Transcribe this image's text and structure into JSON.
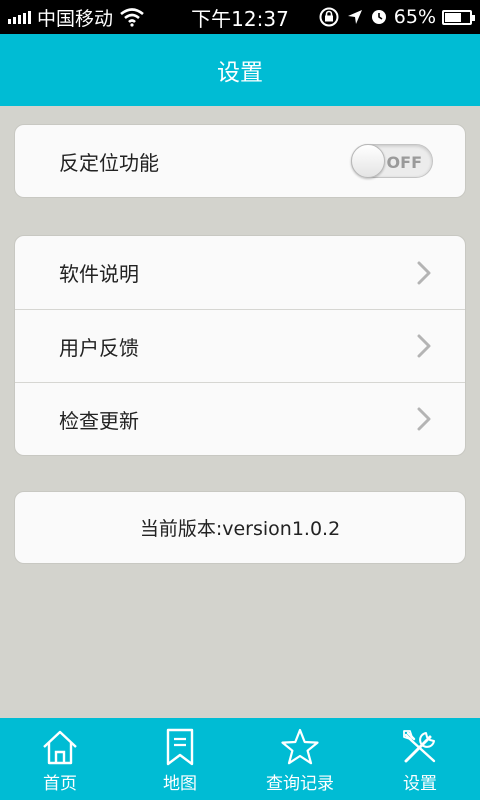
{
  "status_bar": {
    "carrier": "中国移动",
    "time": "下午12:37",
    "battery": "65%",
    "battery_level": 0.65
  },
  "header": {
    "title": "设置"
  },
  "settings": {
    "location": {
      "label": "反定位功能",
      "toggle_text": "OFF",
      "enabled": false
    },
    "menu": [
      {
        "label": "软件说明"
      },
      {
        "label": "用户反馈"
      },
      {
        "label": "检查更新"
      }
    ],
    "version": "当前版本:version1.0.2"
  },
  "tabs": [
    {
      "label": "首页",
      "icon": "home-icon"
    },
    {
      "label": "地图",
      "icon": "bookmark-icon"
    },
    {
      "label": "查询记录",
      "icon": "star-icon"
    },
    {
      "label": "设置",
      "icon": "tools-icon",
      "active": true
    }
  ],
  "colors": {
    "accent": "#00bcd4",
    "background": "#d3d3cd"
  }
}
